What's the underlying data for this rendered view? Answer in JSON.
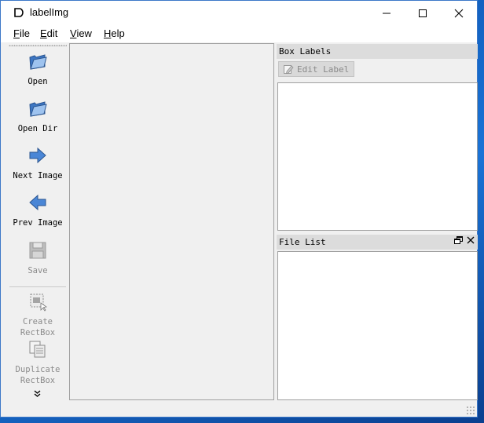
{
  "window": {
    "title": "labelImg"
  },
  "window_controls": {
    "minimize_glyph": "—",
    "maximize_glyph": "□",
    "close_glyph": "✕"
  },
  "menu": [
    {
      "accel": "F",
      "rest": "ile"
    },
    {
      "accel": "E",
      "rest": "dit"
    },
    {
      "accel": "V",
      "rest": "iew"
    },
    {
      "accel": "H",
      "rest": "elp"
    }
  ],
  "toolbar": {
    "open": "Open",
    "open_dir": "Open Dir",
    "next_image": "Next Image",
    "prev_image": "Prev Image",
    "save": "Save",
    "create_rectbox": "Create\nRectBox",
    "duplicate_rectbox": "Duplicate\nRectBox",
    "more": "»"
  },
  "box_labels_dock": {
    "title": "Box Labels",
    "edit_label_button": "Edit Label"
  },
  "file_list_dock": {
    "title": "File List",
    "float_glyph": "🗗",
    "close_glyph": "✕"
  },
  "icons": {
    "app": "labelimg-app-icon",
    "open": "folder-open-icon",
    "open_dir": "folder-open-icon",
    "next": "arrow-right-icon",
    "prev": "arrow-left-icon",
    "save": "floppy-disk-icon",
    "create": "rectbox-create-icon",
    "duplicate": "rectbox-duplicate-icon",
    "edit_label": "pencil-icon"
  },
  "colors": {
    "accent_blue": "#2f6fc0",
    "disabled_text": "#8a8a8a",
    "dock_title_bg": "#dcdcdc"
  }
}
